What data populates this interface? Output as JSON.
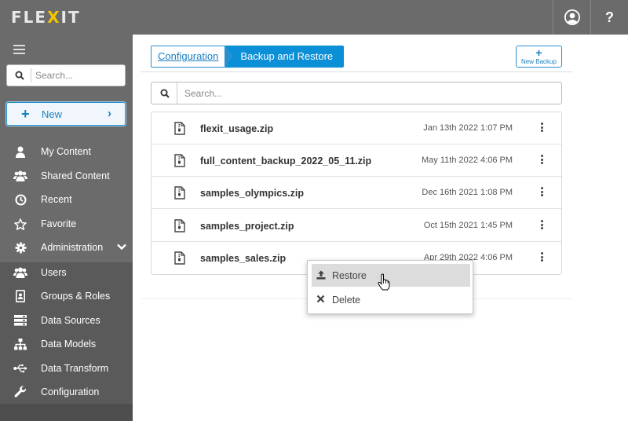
{
  "app": {
    "logo_left": "FLE",
    "logo_x": "X",
    "logo_right": "IT",
    "help_label": "?"
  },
  "sidebar": {
    "search_placeholder": "Search...",
    "new_label": "New",
    "items": [
      {
        "label": "My Content",
        "icon": "user-icon"
      },
      {
        "label": "Shared Content",
        "icon": "group-icon"
      },
      {
        "label": "Recent",
        "icon": "clock-icon"
      },
      {
        "label": "Favorite",
        "icon": "star-icon"
      },
      {
        "label": "Administration",
        "icon": "gear-icon"
      },
      {
        "label": "Users",
        "icon": "group-icon"
      },
      {
        "label": "Groups & Roles",
        "icon": "id-badge-icon"
      },
      {
        "label": "Data Sources",
        "icon": "server-icon"
      },
      {
        "label": "Data Models",
        "icon": "sitemap-icon"
      },
      {
        "label": "Data Transform",
        "icon": "usb-icon"
      },
      {
        "label": "Configuration",
        "icon": "wrench-icon"
      }
    ]
  },
  "breadcrumb": {
    "parent": "Configuration",
    "current": "Backup and Restore"
  },
  "toolbar": {
    "new_backup_plus": "+",
    "new_backup_label": "New Backup"
  },
  "main": {
    "search_placeholder": "Search...",
    "files": [
      {
        "name": "flexit_usage.zip",
        "date": "Jan 13th 2022 1:07 PM"
      },
      {
        "name": "full_content_backup_2022_05_11.zip",
        "date": "May 11th 2022 4:06 PM"
      },
      {
        "name": "samples_olympics.zip",
        "date": "Dec 16th 2021 1:08 PM"
      },
      {
        "name": "samples_project.zip",
        "date": "Oct 15th 2021 1:45 PM"
      },
      {
        "name": "samples_sales.zip",
        "date": "Apr 29th 2022 4:06 PM"
      }
    ]
  },
  "context_menu": {
    "restore_label": "Restore",
    "delete_label": "Delete"
  },
  "colors": {
    "accent": "#0b8fd6",
    "sidebar": "#6b6b6b",
    "logo_x": "#f3c400"
  }
}
